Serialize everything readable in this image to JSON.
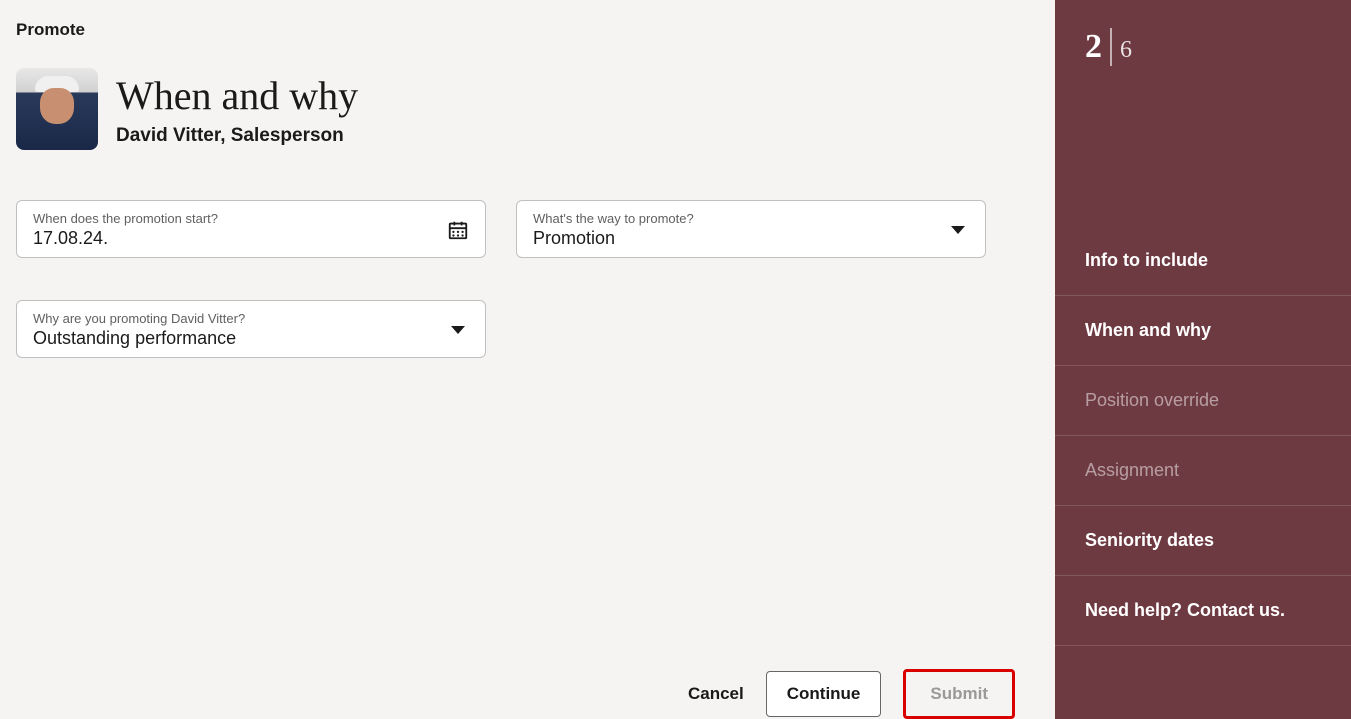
{
  "breadcrumb": "Promote",
  "header": {
    "title": "When and why",
    "employee": "David Vitter, Salesperson"
  },
  "fields": {
    "start": {
      "label": "When does the promotion start?",
      "value": "17.08.24."
    },
    "way": {
      "label": "What's the way to promote?",
      "value": "Promotion"
    },
    "reason": {
      "label": "Why are you promoting David Vitter?",
      "value": "Outstanding performance"
    }
  },
  "actions": {
    "cancel": "Cancel",
    "continue": "Continue",
    "submit": "Submit"
  },
  "sidebar": {
    "current_step": "2",
    "total_steps": "6",
    "items": [
      {
        "label": "Info to include",
        "state": "normal"
      },
      {
        "label": "When and why",
        "state": "active"
      },
      {
        "label": "Position override",
        "state": "dimmed"
      },
      {
        "label": "Assignment",
        "state": "dimmed"
      },
      {
        "label": "Seniority dates",
        "state": "normal"
      },
      {
        "label": "Need help? Contact us.",
        "state": "normal"
      }
    ]
  }
}
